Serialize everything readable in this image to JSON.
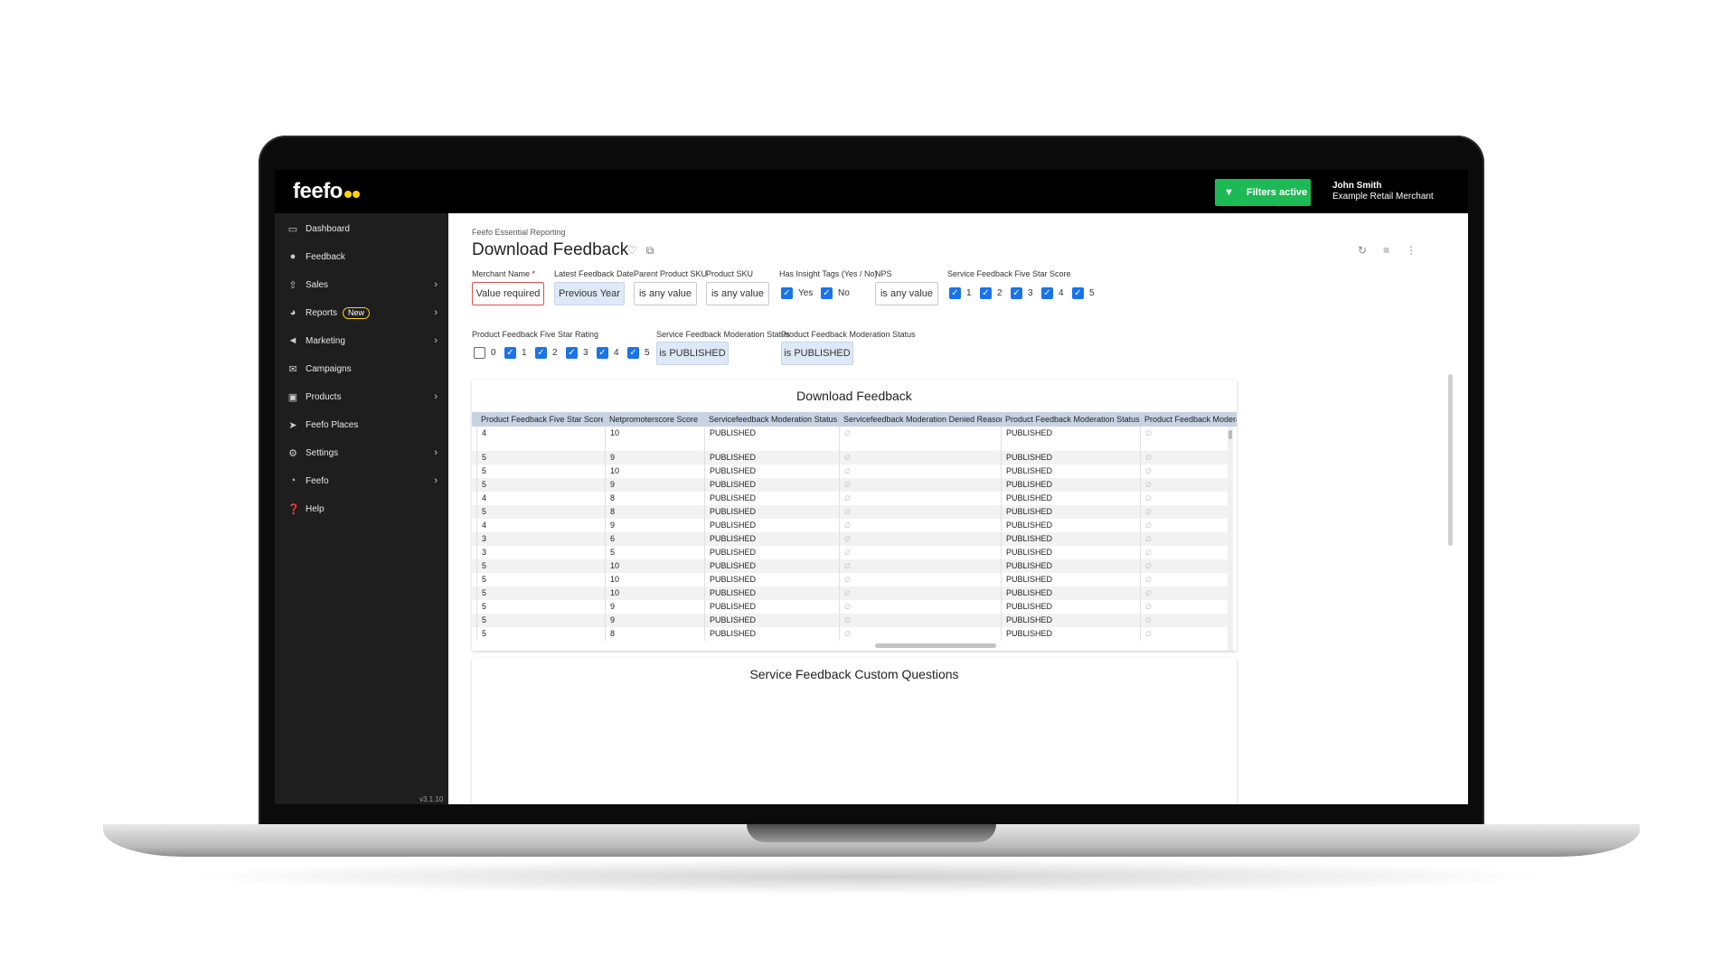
{
  "app": {
    "logo": "feefo"
  },
  "topbar": {
    "filters_label": "Filters active",
    "user_name": "John Smith",
    "user_org": "Example Retail Merchant"
  },
  "sidebar": {
    "items": [
      {
        "label": "Dashboard",
        "icon": "monitor-icon",
        "chevron": false
      },
      {
        "label": "Feedback",
        "icon": "chat-icon",
        "chevron": false
      },
      {
        "label": "Sales",
        "icon": "upload-icon",
        "chevron": true
      },
      {
        "label": "Reports",
        "icon": "chart-pie-icon",
        "chevron": true,
        "badge": "New"
      },
      {
        "label": "Marketing",
        "icon": "megaphone-icon",
        "chevron": true
      },
      {
        "label": "Campaigns",
        "icon": "envelope-icon",
        "chevron": false
      },
      {
        "label": "Products",
        "icon": "bag-icon",
        "chevron": true
      },
      {
        "label": "Feefo Places",
        "icon": "location-arrow-icon",
        "chevron": false
      },
      {
        "label": "Settings",
        "icon": "gear-icon",
        "chevron": true
      },
      {
        "label": "Feefo",
        "icon": "feefo-icon",
        "chevron": true
      },
      {
        "label": "Help",
        "icon": "help-icon",
        "chevron": false
      }
    ],
    "version": "v3.1.10"
  },
  "page": {
    "breadcrumb": "Feefo Essential Reporting",
    "title": "Download Feedback"
  },
  "filters": {
    "merchant_name": {
      "label": "Merchant Name",
      "required": "*",
      "value": "Value required"
    },
    "latest_feedback_date": {
      "label": "Latest Feedback Date",
      "value": "Previous Year"
    },
    "parent_product_sku": {
      "label": "Parent Product SKU",
      "value": "is any value"
    },
    "product_sku": {
      "label": "Product SKU",
      "value": "is any value"
    },
    "has_insight_tags": {
      "label": "Has Insight Tags (Yes / No)",
      "options": [
        {
          "label": "Yes",
          "checked": true
        },
        {
          "label": "No",
          "checked": true
        }
      ]
    },
    "nps": {
      "label": "NPS",
      "value": "is any value"
    },
    "service_five_star": {
      "label": "Service Feedback Five Star Score",
      "options": [
        {
          "label": "1",
          "checked": true
        },
        {
          "label": "2",
          "checked": true
        },
        {
          "label": "3",
          "checked": true
        },
        {
          "label": "4",
          "checked": true
        },
        {
          "label": "5",
          "checked": true
        }
      ]
    },
    "product_five_star": {
      "label": "Product Feedback Five Star Rating",
      "options": [
        {
          "label": "0",
          "checked": false
        },
        {
          "label": "1",
          "checked": true
        },
        {
          "label": "2",
          "checked": true
        },
        {
          "label": "3",
          "checked": true
        },
        {
          "label": "4",
          "checked": true
        },
        {
          "label": "5",
          "checked": true
        }
      ]
    },
    "service_moderation": {
      "label": "Service Feedback Moderation Status",
      "value": "is PUBLISHED"
    },
    "product_moderation": {
      "label": "Product Feedback Moderation Status",
      "value": "is PUBLISHED"
    }
  },
  "download_table": {
    "title": "Download Feedback",
    "columns": [
      "Product Feedback Five Star Score",
      "Netpromoterscore Score",
      "Servicefeedback Moderation Status",
      "Servicefeedback Moderation Denied Reason",
      "Product Feedback Moderation Status",
      "Product Feedback Moderatio"
    ],
    "null_symbol": "∅",
    "rows": [
      [
        "4",
        "10",
        "PUBLISHED",
        "∅",
        "PUBLISHED",
        "∅"
      ],
      [
        "5",
        "9",
        "PUBLISHED",
        "∅",
        "PUBLISHED",
        "∅"
      ],
      [
        "5",
        "10",
        "PUBLISHED",
        "∅",
        "PUBLISHED",
        "∅"
      ],
      [
        "5",
        "9",
        "PUBLISHED",
        "∅",
        "PUBLISHED",
        "∅"
      ],
      [
        "4",
        "8",
        "PUBLISHED",
        "∅",
        "PUBLISHED",
        "∅"
      ],
      [
        "5",
        "8",
        "PUBLISHED",
        "∅",
        "PUBLISHED",
        "∅"
      ],
      [
        "4",
        "9",
        "PUBLISHED",
        "∅",
        "PUBLISHED",
        "∅"
      ],
      [
        "3",
        "6",
        "PUBLISHED",
        "∅",
        "PUBLISHED",
        "∅"
      ],
      [
        "3",
        "5",
        "PUBLISHED",
        "∅",
        "PUBLISHED",
        "∅"
      ],
      [
        "5",
        "10",
        "PUBLISHED",
        "∅",
        "PUBLISHED",
        "∅"
      ],
      [
        "5",
        "10",
        "PUBLISHED",
        "∅",
        "PUBLISHED",
        "∅"
      ],
      [
        "5",
        "10",
        "PUBLISHED",
        "∅",
        "PUBLISHED",
        "∅"
      ],
      [
        "5",
        "9",
        "PUBLISHED",
        "∅",
        "PUBLISHED",
        "∅"
      ],
      [
        "5",
        "9",
        "PUBLISHED",
        "∅",
        "PUBLISHED",
        "∅"
      ],
      [
        "5",
        "8",
        "PUBLISHED",
        "∅",
        "PUBLISHED",
        "∅"
      ]
    ]
  },
  "custom_questions": {
    "title": "Service Feedback Custom Questions"
  },
  "colors": {
    "accent": "#1a73e8",
    "filters_green": "#1db954",
    "brand_yellow": "#ffd400"
  }
}
